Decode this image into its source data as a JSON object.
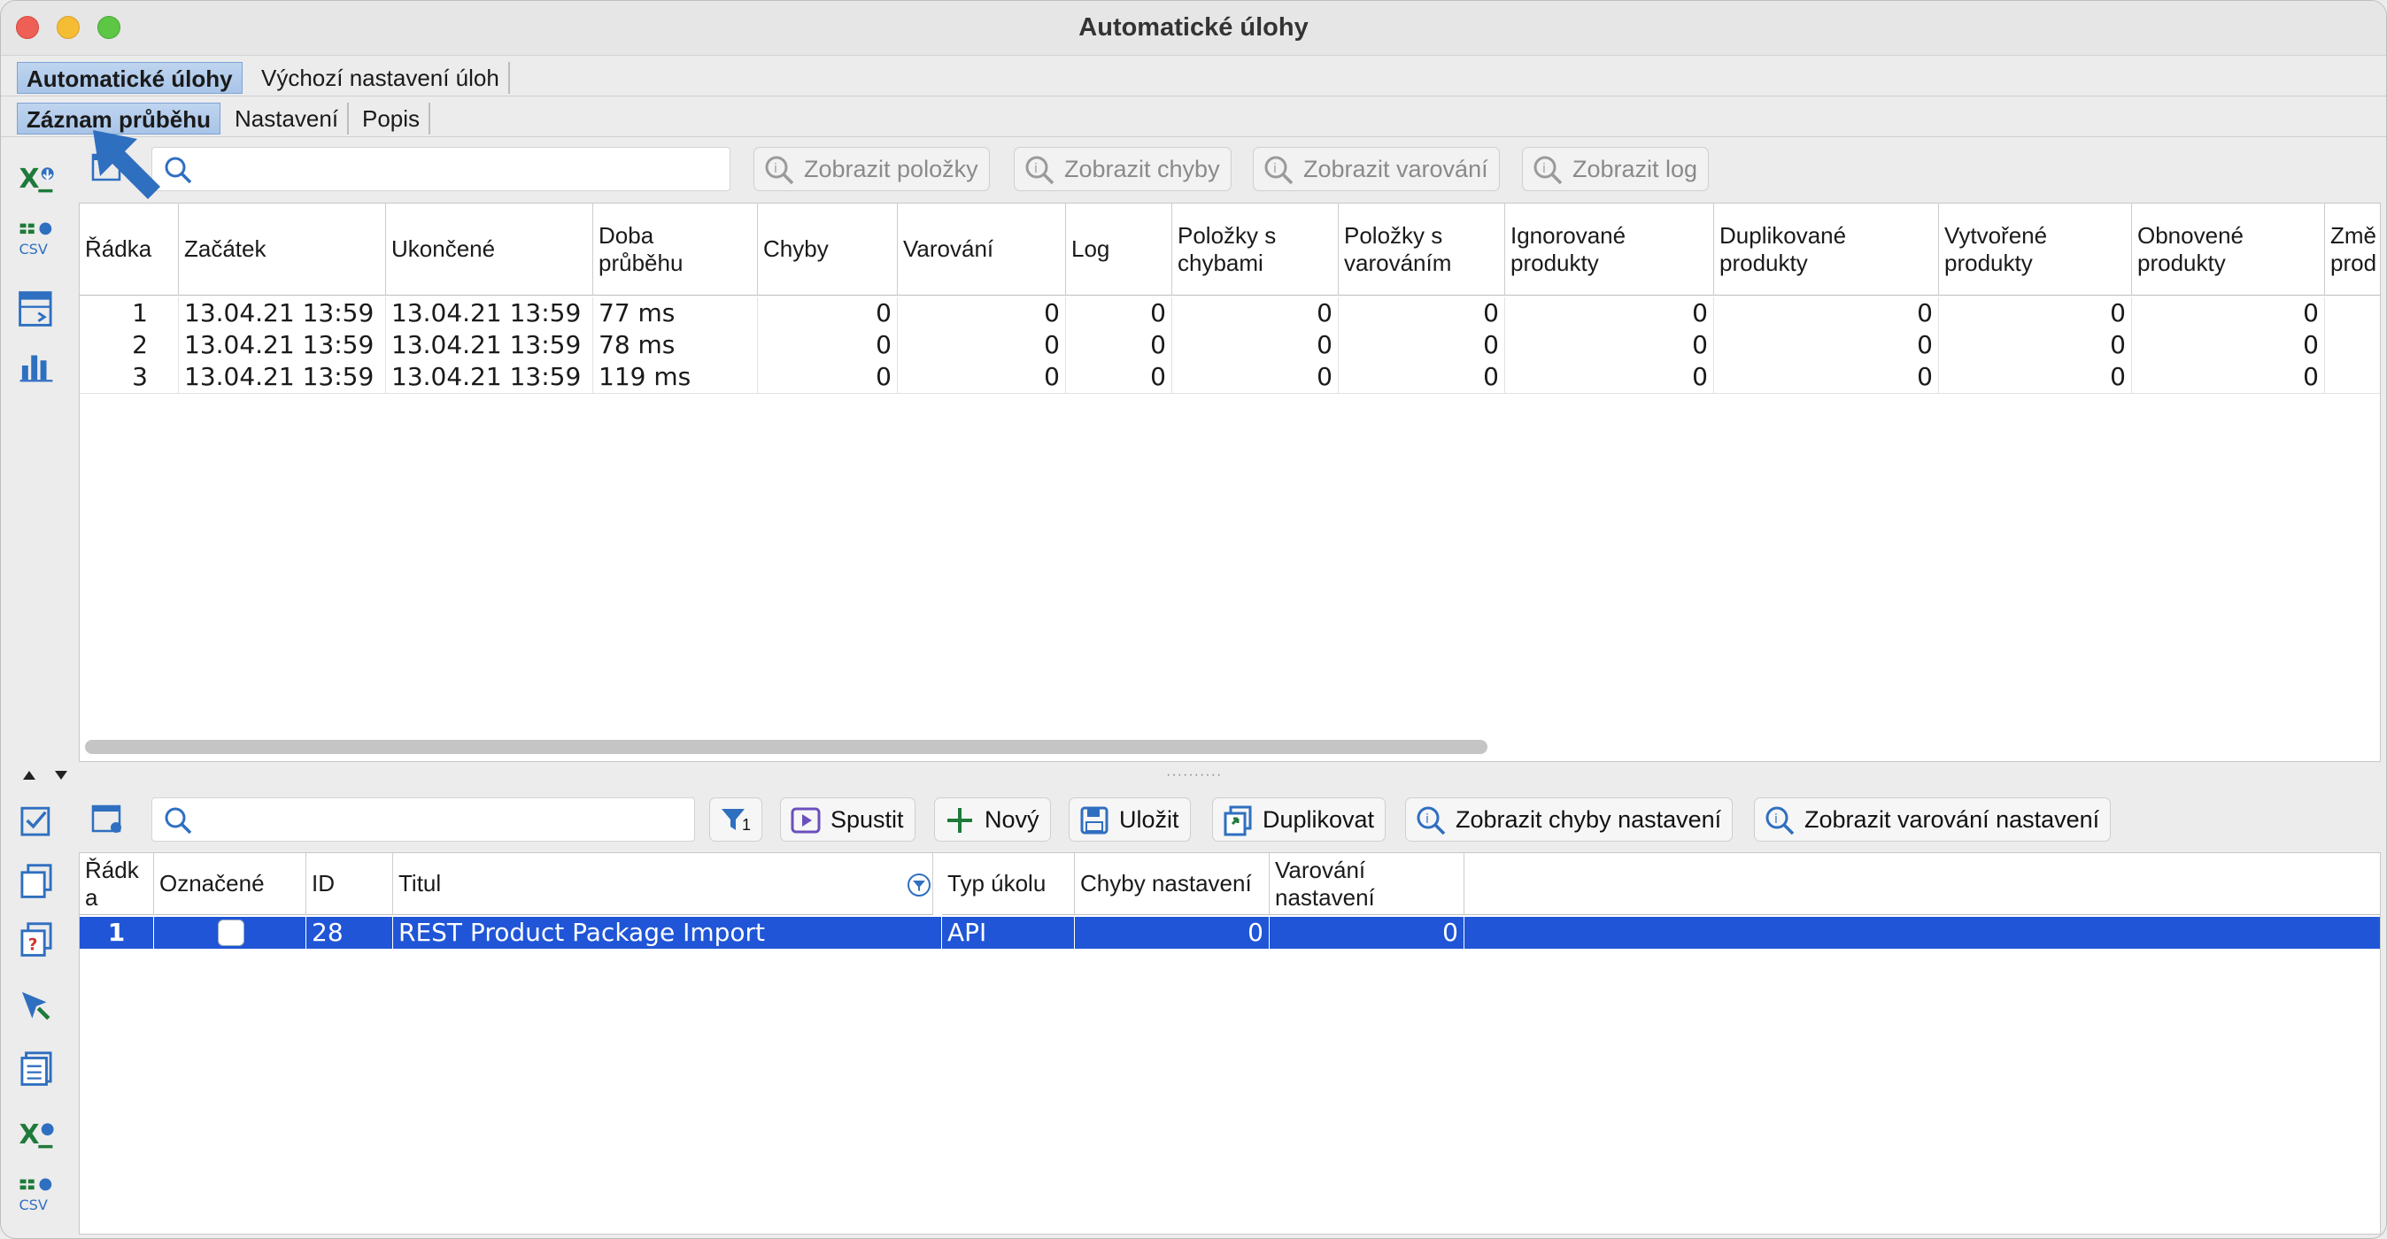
{
  "window": {
    "title": "Automatické úlohy"
  },
  "main_tabs": [
    {
      "label": "Automatické úlohy",
      "active": true
    },
    {
      "label": "Výchozí nastavení úloh",
      "active": false
    }
  ],
  "sub_tabs": [
    {
      "label": "Záznam průběhu",
      "active": true
    },
    {
      "label": "Nastavení",
      "active": false
    },
    {
      "label": "Popis",
      "active": false
    }
  ],
  "top_toolbar": {
    "search_placeholder": "",
    "buttons": [
      {
        "label": "Zobrazit položky",
        "icon": "info-magnifier-icon",
        "enabled": false
      },
      {
        "label": "Zobrazit chyby",
        "icon": "info-magnifier-icon",
        "enabled": false
      },
      {
        "label": "Zobrazit varování",
        "icon": "info-magnifier-icon",
        "enabled": false
      },
      {
        "label": "Zobrazit log",
        "icon": "info-magnifier-icon",
        "enabled": false
      }
    ]
  },
  "log_table": {
    "columns": [
      "Řádka",
      "Začátek",
      "Ukončené",
      "Doba\nprůběhu",
      "Chyby",
      "Varování",
      "Log",
      "Položky s\nchybami",
      "Položky s\nvarováním",
      "Ignorované\nprodukty",
      "Duplikované\nprodukty",
      "Vytvořené\nprodukty",
      "Obnovené\nprodukty",
      "Změ\nprod"
    ],
    "rows": [
      [
        "1",
        "13.04.21 13:59",
        "13.04.21 13:59",
        "77 ms",
        "0",
        "0",
        "0",
        "0",
        "0",
        "0",
        "0",
        "0",
        "0"
      ],
      [
        "2",
        "13.04.21 13:59",
        "13.04.21 13:59",
        "78 ms",
        "0",
        "0",
        "0",
        "0",
        "0",
        "0",
        "0",
        "0",
        "0"
      ],
      [
        "3",
        "13.04.21 13:59",
        "13.04.21 13:59",
        "119 ms",
        "0",
        "0",
        "0",
        "0",
        "0",
        "0",
        "0",
        "0",
        "0"
      ]
    ]
  },
  "bottom_toolbar": {
    "search_placeholder": "",
    "filter_count": "1",
    "buttons": [
      {
        "label": "Spustit",
        "icon": "run-icon"
      },
      {
        "label": "Nový",
        "icon": "plus-icon"
      },
      {
        "label": "Uložit",
        "icon": "save-icon"
      },
      {
        "label": "Duplikovat",
        "icon": "duplicate-icon"
      },
      {
        "label": "Zobrazit chyby nastavení",
        "icon": "info-magnifier-icon"
      },
      {
        "label": "Zobrazit varování nastavení",
        "icon": "info-magnifier-icon"
      }
    ]
  },
  "task_table": {
    "columns": [
      "Řádk\na",
      "Označené",
      "ID",
      "Titul",
      "Typ úkolu",
      "Chyby nastavení",
      "Varování\nnastavení"
    ],
    "rows": [
      {
        "row": "1",
        "checked": false,
        "id": "28",
        "title": "REST Product Package Import",
        "type": "API",
        "setting_errors": "0",
        "setting_warnings": "0",
        "selected": true
      }
    ]
  },
  "colors": {
    "selection": "#1f55d6",
    "active_tab": "#a8c4e8",
    "annotation_arrow": "#2f6fc0"
  }
}
